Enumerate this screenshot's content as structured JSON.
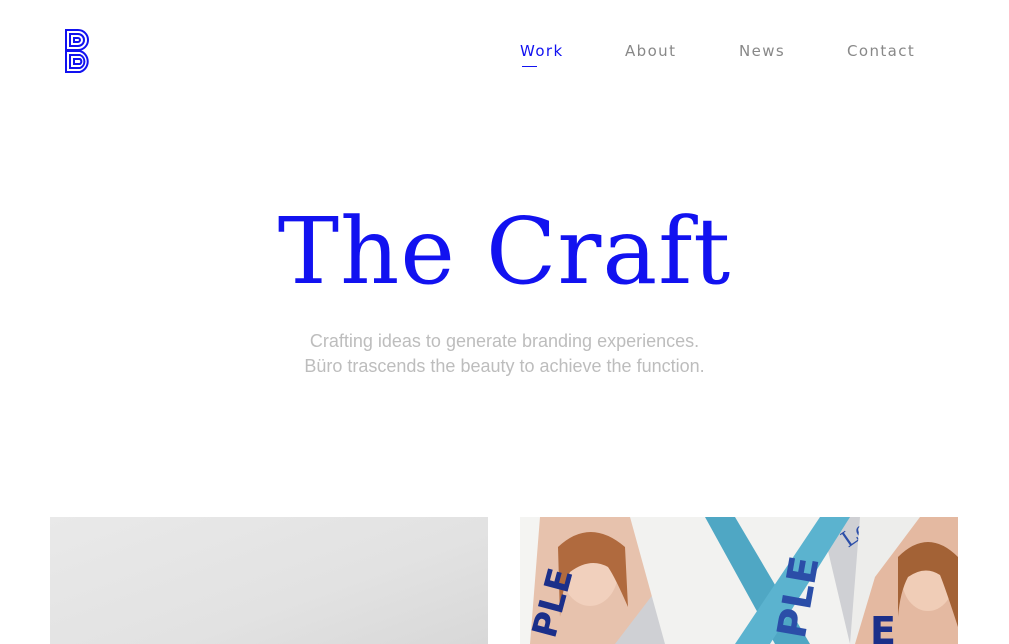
{
  "brand": {
    "logo_icon": "b-monogram-icon",
    "accent_color": "#1212f0"
  },
  "nav": {
    "items": [
      {
        "label": "Work",
        "active": true
      },
      {
        "label": "About",
        "active": false
      },
      {
        "label": "News",
        "active": false
      },
      {
        "label": "Contact",
        "active": false
      }
    ]
  },
  "hero": {
    "title": "The Craft",
    "subtitle_line1": "Crafting ideas to generate branding experiences.",
    "subtitle_line2": "Büro trascends the beauty to achieve the function."
  },
  "work": {
    "cards": [
      {
        "image": "grey-gradient-photo"
      },
      {
        "image": "magazine-spreads-photo",
        "visible_text": [
          "PLE",
          "PLE",
          "Le"
        ]
      }
    ]
  }
}
